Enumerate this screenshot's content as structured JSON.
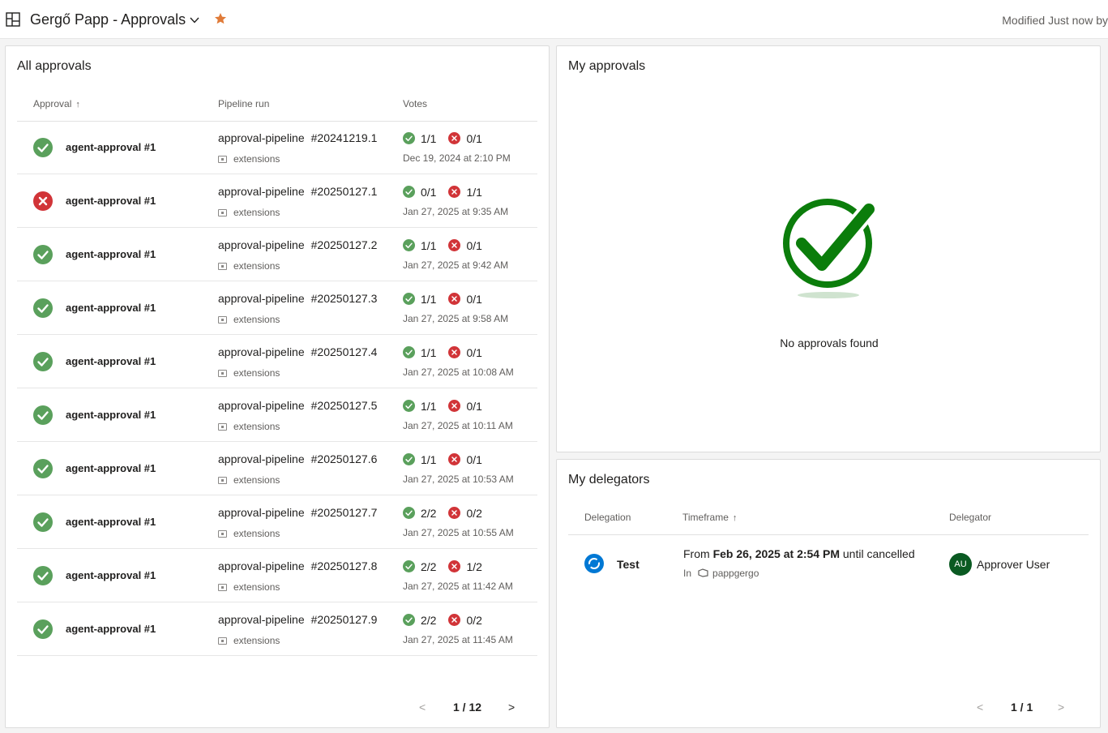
{
  "header": {
    "title": "Gergő Papp - Approvals",
    "modified": "Modified Just now by"
  },
  "colors": {
    "approved_green": "#5aa05c",
    "rejected_red": "#d13438",
    "star_orange": "#e07b39",
    "avatar_green": "#0a5a22",
    "check_green": "#0b7d0b"
  },
  "all_approvals": {
    "title": "All approvals",
    "columns": {
      "approval": "Approval",
      "pipeline_run": "Pipeline run",
      "votes": "Votes"
    },
    "sort_arrow": "↑",
    "rows": [
      {
        "status": "approved",
        "name": "agent-approval #1",
        "pipeline": "approval-pipeline",
        "run": "#20241219.1",
        "repo": "extensions",
        "approve_votes": "1/1",
        "reject_votes": "0/1",
        "date": "Dec 19, 2024 at 2:10 PM"
      },
      {
        "status": "rejected",
        "name": "agent-approval #1",
        "pipeline": "approval-pipeline",
        "run": "#20250127.1",
        "repo": "extensions",
        "approve_votes": "0/1",
        "reject_votes": "1/1",
        "date": "Jan 27, 2025 at 9:35 AM"
      },
      {
        "status": "approved",
        "name": "agent-approval #1",
        "pipeline": "approval-pipeline",
        "run": "#20250127.2",
        "repo": "extensions",
        "approve_votes": "1/1",
        "reject_votes": "0/1",
        "date": "Jan 27, 2025 at 9:42 AM"
      },
      {
        "status": "approved",
        "name": "agent-approval #1",
        "pipeline": "approval-pipeline",
        "run": "#20250127.3",
        "repo": "extensions",
        "approve_votes": "1/1",
        "reject_votes": "0/1",
        "date": "Jan 27, 2025 at 9:58 AM"
      },
      {
        "status": "approved",
        "name": "agent-approval #1",
        "pipeline": "approval-pipeline",
        "run": "#20250127.4",
        "repo": "extensions",
        "approve_votes": "1/1",
        "reject_votes": "0/1",
        "date": "Jan 27, 2025 at 10:08 AM"
      },
      {
        "status": "approved",
        "name": "agent-approval #1",
        "pipeline": "approval-pipeline",
        "run": "#20250127.5",
        "repo": "extensions",
        "approve_votes": "1/1",
        "reject_votes": "0/1",
        "date": "Jan 27, 2025 at 10:11 AM"
      },
      {
        "status": "approved",
        "name": "agent-approval #1",
        "pipeline": "approval-pipeline",
        "run": "#20250127.6",
        "repo": "extensions",
        "approve_votes": "1/1",
        "reject_votes": "0/1",
        "date": "Jan 27, 2025 at 10:53 AM"
      },
      {
        "status": "approved",
        "name": "agent-approval #1",
        "pipeline": "approval-pipeline",
        "run": "#20250127.7",
        "repo": "extensions",
        "approve_votes": "2/2",
        "reject_votes": "0/2",
        "date": "Jan 27, 2025 at 10:55 AM"
      },
      {
        "status": "approved",
        "name": "agent-approval #1",
        "pipeline": "approval-pipeline",
        "run": "#20250127.8",
        "repo": "extensions",
        "approve_votes": "2/2",
        "reject_votes": "1/2",
        "date": "Jan 27, 2025 at 11:42 AM"
      },
      {
        "status": "approved",
        "name": "agent-approval #1",
        "pipeline": "approval-pipeline",
        "run": "#20250127.9",
        "repo": "extensions",
        "approve_votes": "2/2",
        "reject_votes": "0/2",
        "date": "Jan 27, 2025 at 11:45 AM"
      }
    ],
    "pager": {
      "prev": "<",
      "page": "1 / 12",
      "next": ">"
    }
  },
  "my_approvals": {
    "title": "My approvals",
    "empty_text": "No approvals found"
  },
  "my_delegators": {
    "title": "My delegators",
    "columns": {
      "delegation": "Delegation",
      "timeframe": "Timeframe",
      "delegator": "Delegator"
    },
    "sort_arrow": "↑",
    "rows": [
      {
        "name": "Test",
        "from_label": "From",
        "from": "Feb 26, 2025 at 2:54 PM",
        "until": "until cancelled",
        "in_label": "In",
        "project": "pappgergo",
        "avatar_initials": "AU",
        "delegator": "Approver User"
      }
    ],
    "pager": {
      "prev": "<",
      "page": "1 / 1",
      "next": ">"
    }
  }
}
